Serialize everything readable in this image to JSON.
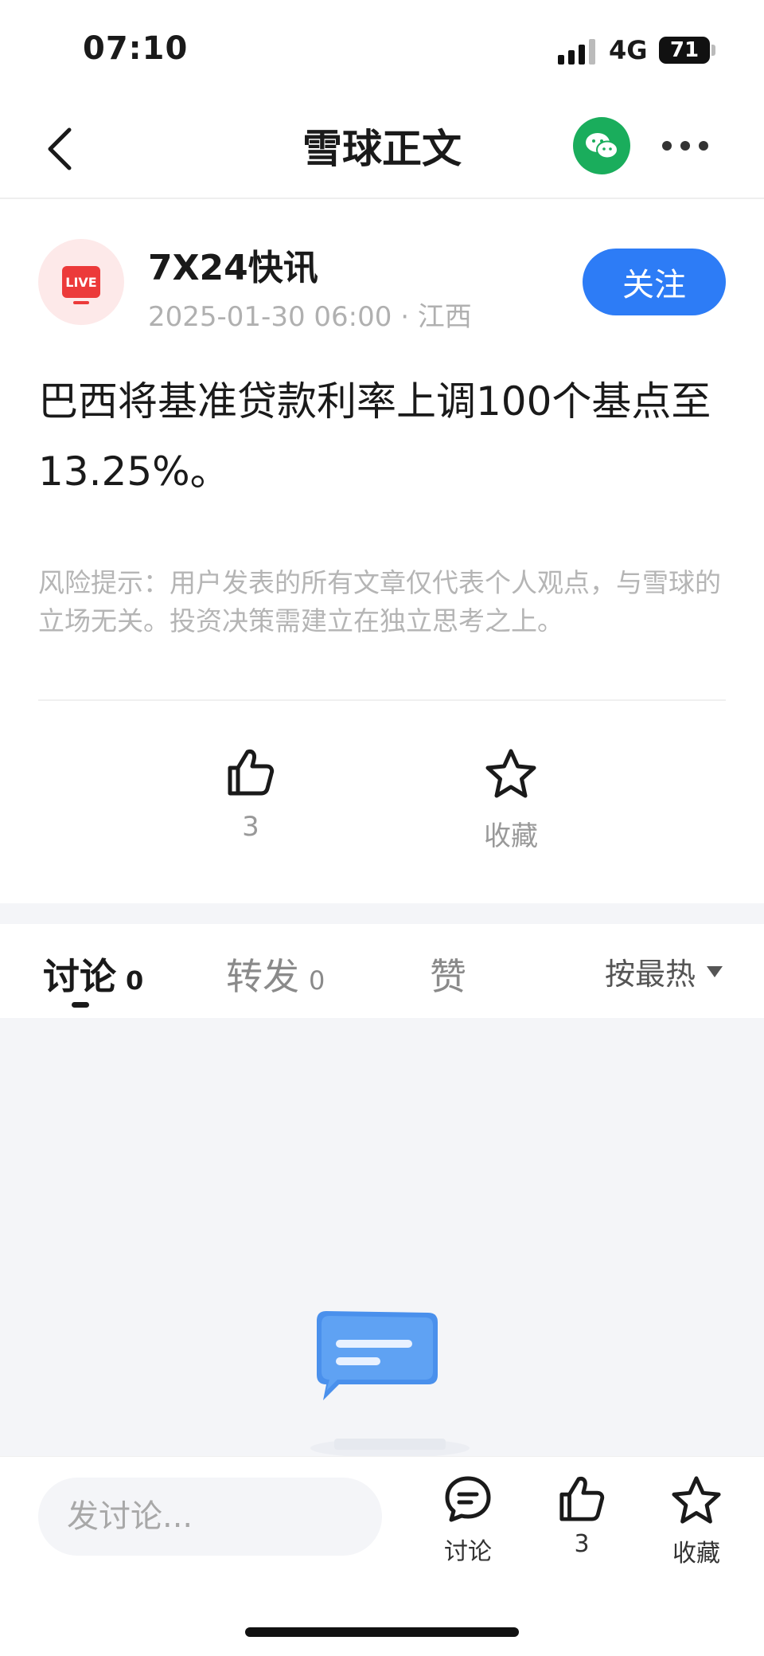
{
  "status_bar": {
    "time": "07:10",
    "network": "4G",
    "battery": "71"
  },
  "nav": {
    "title": "雪球正文"
  },
  "author": {
    "name": "7X24快讯",
    "meta": "2025-01-30 06:00 · 江西",
    "avatar_badge": "LIVE",
    "follow_label": "关注"
  },
  "article": {
    "body": "巴西将基准贷款利率上调100个基点至13.25%。",
    "risk_note": "风险提示：用户发表的所有文章仅代表个人观点，与雪球的立场无关。投资决策需建立在独立思考之上。"
  },
  "actions": {
    "like_count": "3",
    "favorite_label": "收藏"
  },
  "tabs": [
    {
      "label": "讨论",
      "count": "0"
    },
    {
      "label": "转发",
      "count": "0"
    },
    {
      "label": "赞",
      "count": ""
    }
  ],
  "sort": {
    "label": "按最热"
  },
  "bottom_bar": {
    "input_placeholder": "发讨论...",
    "discuss_label": "讨论",
    "like_count": "3",
    "favorite_label": "收藏"
  },
  "colors": {
    "accent": "#2d7cf6",
    "wechat": "#1aad5c",
    "live": "#ec3a3a"
  }
}
